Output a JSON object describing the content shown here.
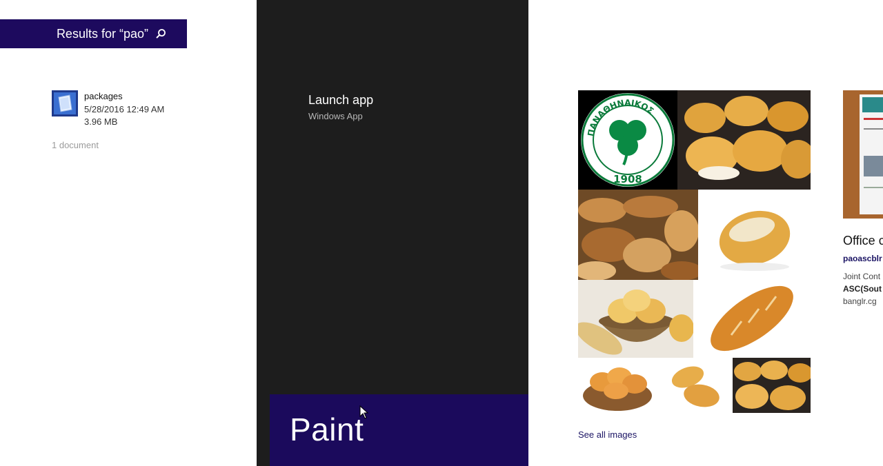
{
  "search": {
    "header_text": "Results for “pao”",
    "icon": "search-icon"
  },
  "files": {
    "items": [
      {
        "name": "packages",
        "date": "5/28/2016 12:49 AM",
        "size": "3.96 MB",
        "icon": "document-icon"
      }
    ],
    "count_label": "1 document"
  },
  "app": {
    "action_title": "Launch app",
    "action_subtitle": "Windows App",
    "tile_name": "Paint",
    "tile_color": "#1b0a5c"
  },
  "images": {
    "see_all_label": "See all images",
    "logo_text": "ΠΑΝΑΘΗΝΑΙΚΟΣ",
    "logo_year": "1908"
  },
  "web_result": {
    "title": "Office c",
    "link": "paoascblr",
    "desc_line1": "Joint Cont",
    "desc_line2": "ASC(Sout",
    "desc_line3": "banglr.cg"
  },
  "colors": {
    "accent": "#1d0a5e",
    "panel_bg": "#1d1d1d",
    "link": "#1b1464"
  }
}
